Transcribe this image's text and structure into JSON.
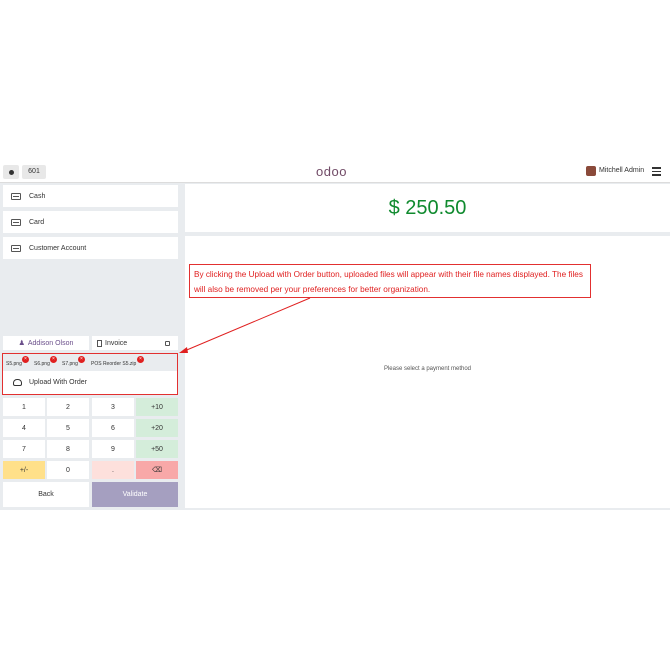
{
  "topbar": {
    "order_number": "601",
    "logo": "odoo",
    "user_name": "Mitchell Admin"
  },
  "payment_methods": [
    {
      "label": "Cash"
    },
    {
      "label": "Card"
    },
    {
      "label": "Customer Account"
    }
  ],
  "amount_due": "$ 250.50",
  "placeholder": "Please select a payment method",
  "callout_text": "By clicking the Upload with Order button, uploaded files will appear with their file names displayed. The files will also be removed per your preferences for better organization.",
  "customer": "Addison Olson",
  "invoice_label": "Invoice",
  "files": [
    "S5.png",
    "S6.png",
    "S7.png",
    "POS Reorder S5.zip"
  ],
  "upload_label": "Upload With Order",
  "keypad": [
    [
      "1",
      "2",
      "3",
      "+10"
    ],
    [
      "4",
      "5",
      "6",
      "+20"
    ],
    [
      "7",
      "8",
      "9",
      "+50"
    ],
    [
      "+/-",
      "0",
      ".",
      "⌫"
    ]
  ],
  "back_label": "Back",
  "validate_label": "Validate",
  "colors": {
    "amount": "#0f8a2e",
    "validate": "#a59fc0",
    "annotation": "#e02020",
    "brand": "#714B67"
  }
}
